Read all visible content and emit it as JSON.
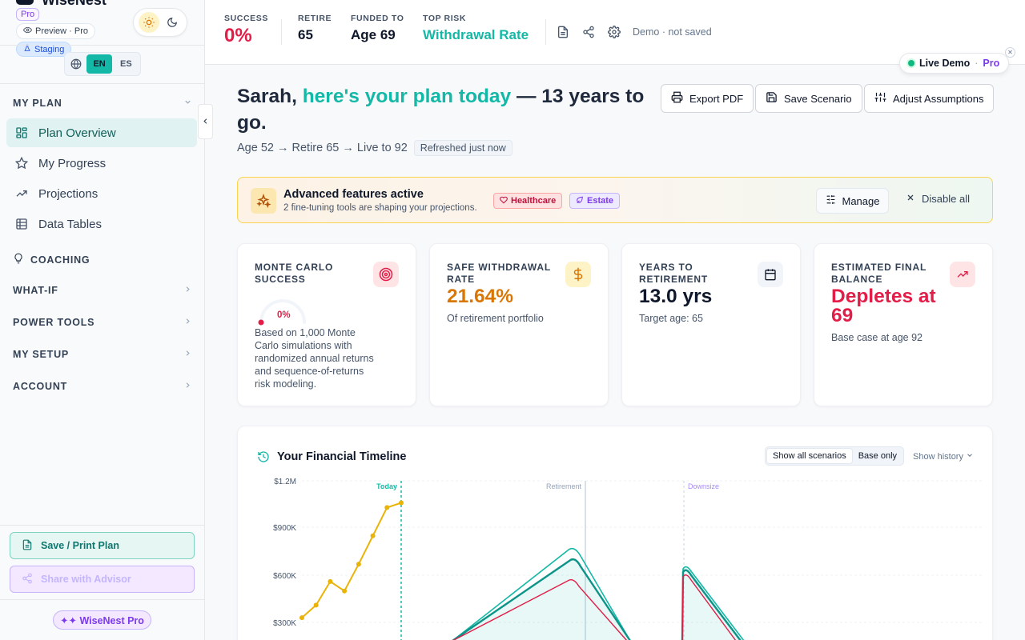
{
  "app": {
    "name": "WiseNest",
    "plan_badge": "Pro",
    "preview_label": "Preview · Pro",
    "env_label": "Staging",
    "languages": [
      "EN",
      "ES"
    ],
    "active_language": "EN"
  },
  "sidebar": {
    "my_plan_label": "MY PLAN",
    "my_plan_items": [
      {
        "label": "Plan Overview",
        "icon": "grid-icon",
        "active": true
      },
      {
        "label": "My Progress",
        "icon": "star-icon"
      },
      {
        "label": "Projections",
        "icon": "trend-up-icon"
      },
      {
        "label": "Data Tables",
        "icon": "table-icon"
      }
    ],
    "coaching_label": "COACHING",
    "sections": [
      "WHAT-IF",
      "POWER TOOLS",
      "MY SETUP",
      "ACCOUNT"
    ],
    "save_print_label": "Save / Print Plan",
    "share_advisor_label": "Share with Advisor",
    "pro_badge_label": "✦✦ WiseNest Pro"
  },
  "header": {
    "stats": [
      {
        "label": "SUCCESS",
        "value": "0%",
        "color": "#e11d48"
      },
      {
        "label": "RETIRE",
        "value": "65",
        "color": "#0f172a"
      },
      {
        "label": "FUNDED TO",
        "value": "Age 69",
        "color": "#0f172a"
      },
      {
        "label": "TOP RISK",
        "value": "Withdrawal Rate",
        "color": "#14b8a6"
      }
    ],
    "demo_status": "Demo · not saved",
    "live_demo_label": "Live Demo",
    "live_demo_sep": "·",
    "live_demo_pro": "Pro"
  },
  "greeting": {
    "name_part": "Sarah,",
    "accent_part": "here's your plan today",
    "rest_part": "— 13 years to go.",
    "subline": "Age 52 → Retire 65 → Live to 92",
    "refreshed": "Refreshed just now"
  },
  "actions": {
    "export_pdf": "Export PDF",
    "save_scenario": "Save Scenario",
    "adjust_assumptions": "Adjust Assumptions"
  },
  "banner": {
    "title": "Advanced features active",
    "subtitle": "2 fine-tuning tools are shaping your projections.",
    "tags": [
      "Healthcare",
      "Estate"
    ],
    "manage_label": "Manage",
    "disable_label": "Disable all"
  },
  "cards": {
    "monte_carlo": {
      "label": "MONTE CARLO SUCCESS",
      "value": "0%",
      "success_fraction": 0,
      "description": "Based on 1,000 Monte Carlo simulations with randomized annual returns and sequence-of-returns risk modeling."
    },
    "withdrawal": {
      "label": "SAFE WITHDRAWAL RATE",
      "value": "21.64%",
      "sub": "Of retirement portfolio"
    },
    "years": {
      "label": "YEARS TO RETIREMENT",
      "value": "13.0 yrs",
      "sub": "Target age: 65"
    },
    "final_balance": {
      "label": "ESTIMATED FINAL BALANCE",
      "value": "Depletes at 69",
      "sub": "Base case at age 92"
    }
  },
  "timeline": {
    "title": "Your Financial Timeline",
    "scenario_toggle": [
      "Show all scenarios",
      "Base only"
    ],
    "active_toggle": "Show all scenarios",
    "show_history": "Show history",
    "markers": [
      "Today",
      "Retirement",
      "Downsize"
    ],
    "chart_data": {
      "type": "line",
      "y_ticks": [
        "$1.2M",
        "$900K",
        "$600K",
        "$300K"
      ],
      "yunits_max": 1200000,
      "history": [
        {
          "x": 0,
          "y": 330000
        },
        {
          "x": 1,
          "y": 410000
        },
        {
          "x": 2,
          "y": 560000
        },
        {
          "x": 3,
          "y": 500000
        },
        {
          "x": 4,
          "y": 670000
        },
        {
          "x": 5,
          "y": 850000
        },
        {
          "x": 6,
          "y": 1030000
        },
        {
          "x": 7,
          "y": 1060000
        }
      ]
    }
  },
  "colors": {
    "accent": "#14b8a6",
    "danger": "#e11d48",
    "warning": "#d97706",
    "purple": "#7c3aed"
  }
}
